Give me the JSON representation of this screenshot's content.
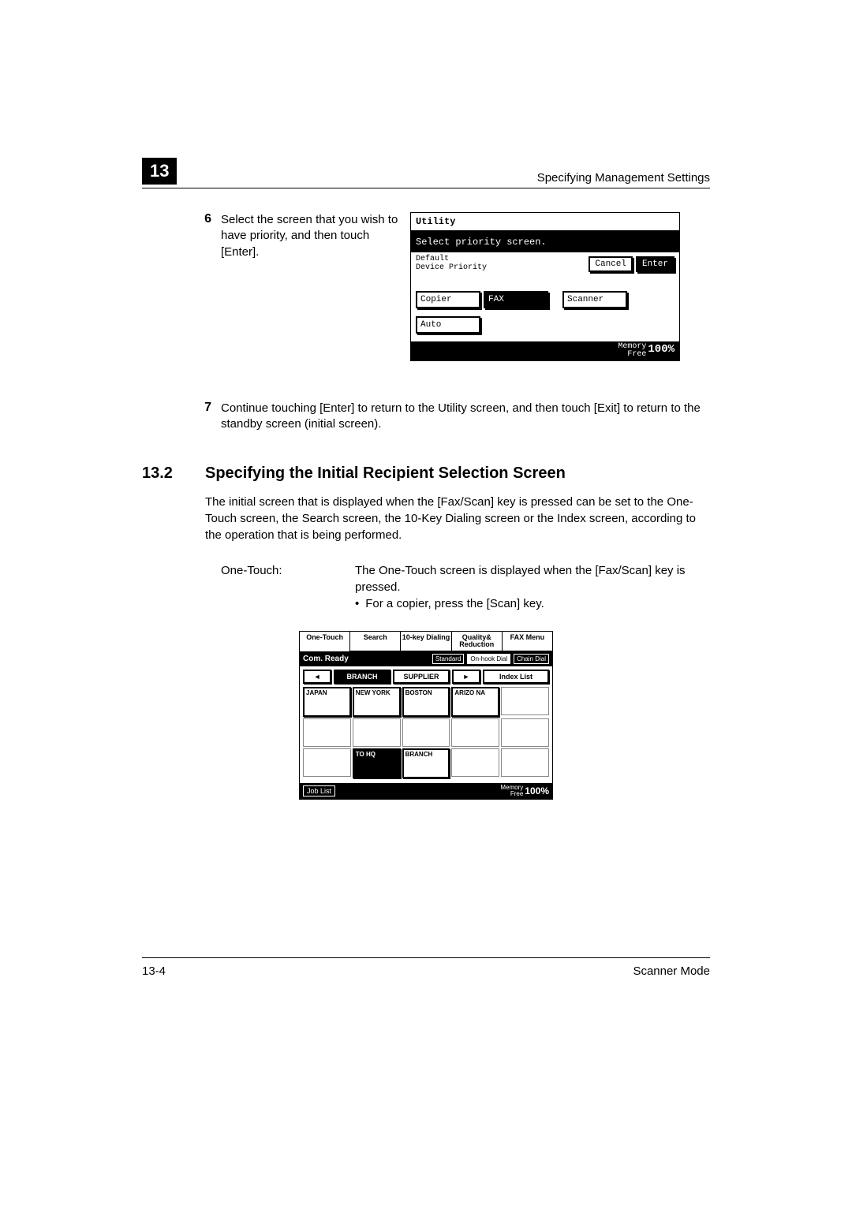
{
  "header": {
    "chapter": "13",
    "title": "Specifying Management Settings"
  },
  "step6": {
    "num": "6",
    "text": "Select the screen that you wish to have priority, and then touch [Enter]."
  },
  "utility": {
    "title": "Utility",
    "banner": "Select priority screen.",
    "label1": "Default",
    "label2": "Device Priority",
    "cancel": "Cancel",
    "enter": "Enter",
    "optCopier": "Copier",
    "optFax": "FAX",
    "optScanner": "Scanner",
    "optAuto": "Auto",
    "memLabel1": "Memory",
    "memLabel2": "Free",
    "memPct": "100%"
  },
  "step7": {
    "num": "7",
    "text": "Continue touching [Enter] to return to the Utility screen, and then touch [Exit] to return to the standby screen (initial screen)."
  },
  "section": {
    "num": "13.2",
    "title": "Specifying the Initial Recipient Selection Screen",
    "intro": "The initial screen that is displayed when the [Fax/Scan] key is pressed can be set to the One-Touch screen, the Search screen, the 10-Key Dialing screen or the Index screen, according to the operation that is being performed."
  },
  "def": {
    "term": "One-Touch:",
    "line1": "The One-Touch screen is displayed when the [Fax/Scan] key is pressed.",
    "bullet": "For a copier, press the [Scan] key."
  },
  "ot": {
    "tabs": [
      "One-Touch",
      "Search",
      "10-key Dialing",
      "Quality& Reduction",
      "FAX Menu"
    ],
    "ready": "Com. Ready",
    "std": "Standard",
    "onhook": "On-hook Dial",
    "chain": "Chain Dial",
    "branch": "BRANCH",
    "supplier": "SUPPLIER",
    "index": "Index List",
    "cells": [
      "JAPAN",
      "NEW YORK",
      "BOSTON",
      "ARIZO NA",
      "",
      "",
      "",
      "",
      "",
      "",
      "",
      "TO HQ",
      "BRANCH",
      "",
      ""
    ],
    "joblist": "Job List",
    "memLabel1": "Memory",
    "memLabel2": "Free",
    "memPct": "100%"
  },
  "footer": {
    "page": "13-4",
    "mode": "Scanner Mode"
  }
}
